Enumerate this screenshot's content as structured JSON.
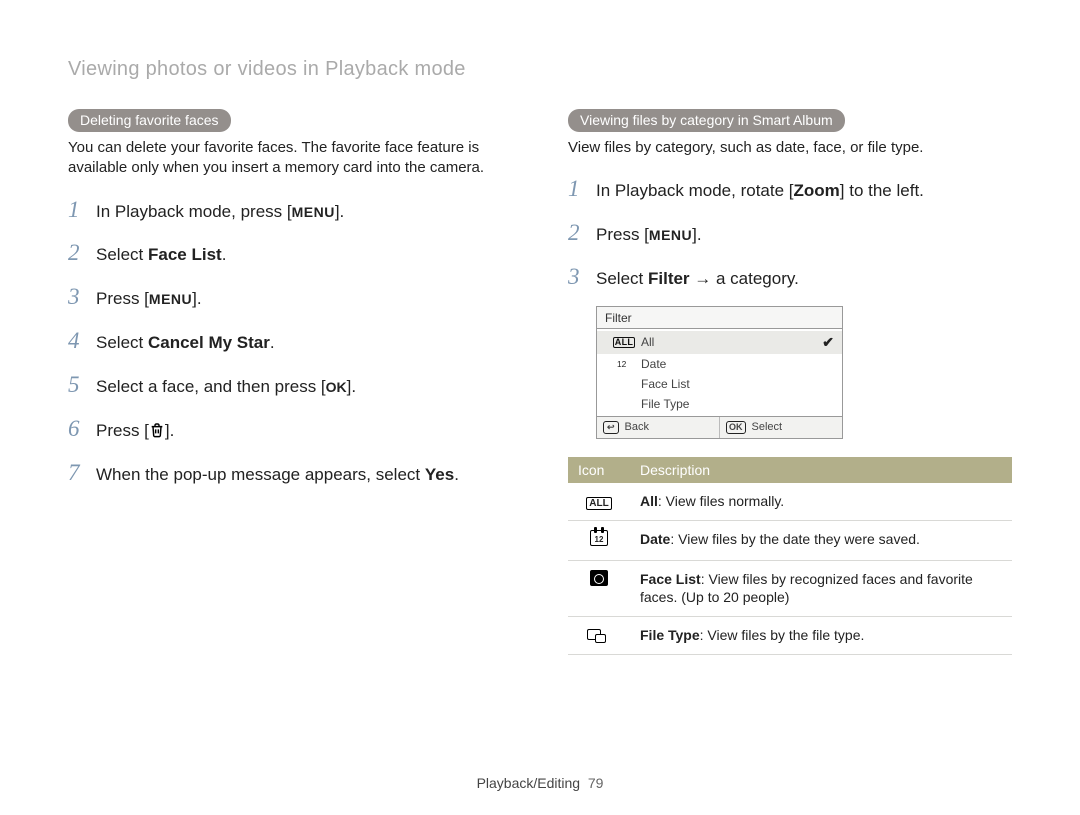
{
  "page_heading": "Viewing photos or videos in Playback mode",
  "left": {
    "pill": "Deleting favorite faces",
    "intro": "You can delete your favorite faces. The favorite face feature is available only when you insert a memory card into the camera.",
    "steps": {
      "s1_pre": "In Playback mode, press [",
      "s1_mid": "MENU",
      "s1_post": "].",
      "s2_pre": "Select ",
      "s2_bold": "Face List",
      "s2_post": ".",
      "s3_pre": "Press [",
      "s3_mid": "MENU",
      "s3_post": "].",
      "s4_pre": "Select ",
      "s4_bold": "Cancel My Star",
      "s4_post": ".",
      "s5_pre": "Select a face, and then press [",
      "s5_mid": "OK",
      "s5_post": "].",
      "s6_pre": "Press [",
      "s6_post": "].",
      "s7_pre": "When the pop-up message appears, select ",
      "s7_bold": "Yes",
      "s7_post": "."
    }
  },
  "right": {
    "pill": "Viewing files by category in Smart Album",
    "intro": "View files by category, such as date, face, or file type.",
    "steps": {
      "s1_pre": "In Playback mode, rotate [",
      "s1_bold": "Zoom",
      "s1_post": "] to the left.",
      "s2_pre": "Press [",
      "s2_mid": "MENU",
      "s2_post": "].",
      "s3_pre": "Select ",
      "s3_bold": "Filter",
      "s3_mid": " → ",
      "s3_post": "a category."
    },
    "ui": {
      "title": "Filter",
      "rows": {
        "all_glyph": "ALL",
        "all": "All",
        "date": "Date",
        "face": "Face List",
        "filetype": "File Type"
      },
      "footer": {
        "back_btn": "↩",
        "back_label": "Back",
        "ok_btn": "OK",
        "select_label": "Select"
      }
    },
    "table": {
      "th_icon": "Icon",
      "th_desc": "Description",
      "row1": {
        "glyph": "ALL",
        "b": "All",
        "rest": ": View files normally."
      },
      "row2": {
        "glyph_num": "12",
        "b": "Date",
        "rest": ": View files by the date they were saved."
      },
      "row3": {
        "b": "Face List",
        "rest": ": View files by recognized faces and favorite faces. (Up to 20 people)"
      },
      "row4": {
        "b": "File Type",
        "rest": ": View files by the file type."
      }
    }
  },
  "footer": {
    "section": "Playback/Editing",
    "page": "79"
  }
}
